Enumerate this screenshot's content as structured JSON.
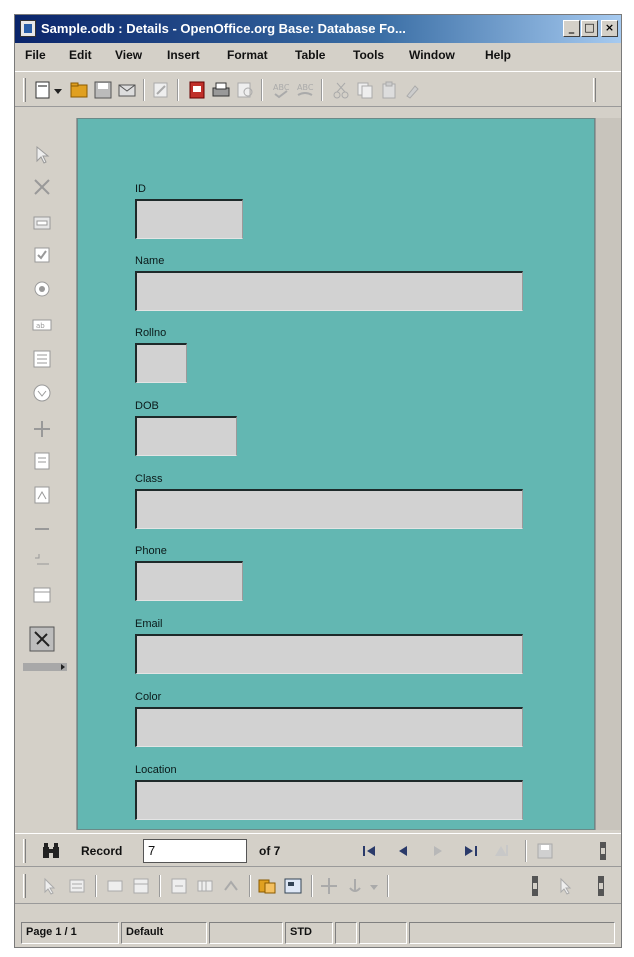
{
  "window": {
    "title": "Sample.odb : Details - OpenOffice.org Base: Database Fo...",
    "minimize_label": "_",
    "maximize_label": "□",
    "close_label": "×"
  },
  "menu": [
    "File",
    "Edit",
    "View",
    "Insert",
    "Format",
    "Table",
    "Tools",
    "Window",
    "Help"
  ],
  "form": {
    "fields": [
      {
        "label": "ID"
      },
      {
        "label": "Name"
      },
      {
        "label": "Rollno"
      },
      {
        "label": "DOB"
      },
      {
        "label": "Class"
      },
      {
        "label": "Phone"
      },
      {
        "label": "Email"
      },
      {
        "label": "Color"
      },
      {
        "label": "Location"
      }
    ],
    "background_color": "#63b7b2"
  },
  "navigation": {
    "record_label": "Record",
    "record_value": "7",
    "of_text": "of 7"
  },
  "status": {
    "page": "Page 1 / 1",
    "style": "Default",
    "mode": "STD"
  },
  "icons": {
    "toolbar": [
      "new-document-icon",
      "dropdown-arrow-icon",
      "open-folder-icon",
      "save-icon",
      "email-icon",
      "edit-file-icon",
      "export-pdf-icon",
      "print-icon",
      "print-preview-icon",
      "spellcheck-icon",
      "autospellcheck-icon",
      "cut-icon",
      "copy-icon",
      "paste-icon",
      "format-paintbrush-icon"
    ],
    "sidebar": [
      "select-icon",
      "control-wizard-icon",
      "form-design-icon",
      "checkbox-icon",
      "radio-icon",
      "text-box-icon",
      "list-box-icon",
      "combo-box-icon",
      "push-button-icon",
      "image-button-icon",
      "label-icon",
      "group-box-icon",
      "more-controls-icon"
    ],
    "navigation": [
      "find-record-icon",
      "first-record-icon",
      "previous-record-icon",
      "next-record-icon",
      "last-record-icon",
      "new-record-icon",
      "save-record-icon"
    ]
  }
}
